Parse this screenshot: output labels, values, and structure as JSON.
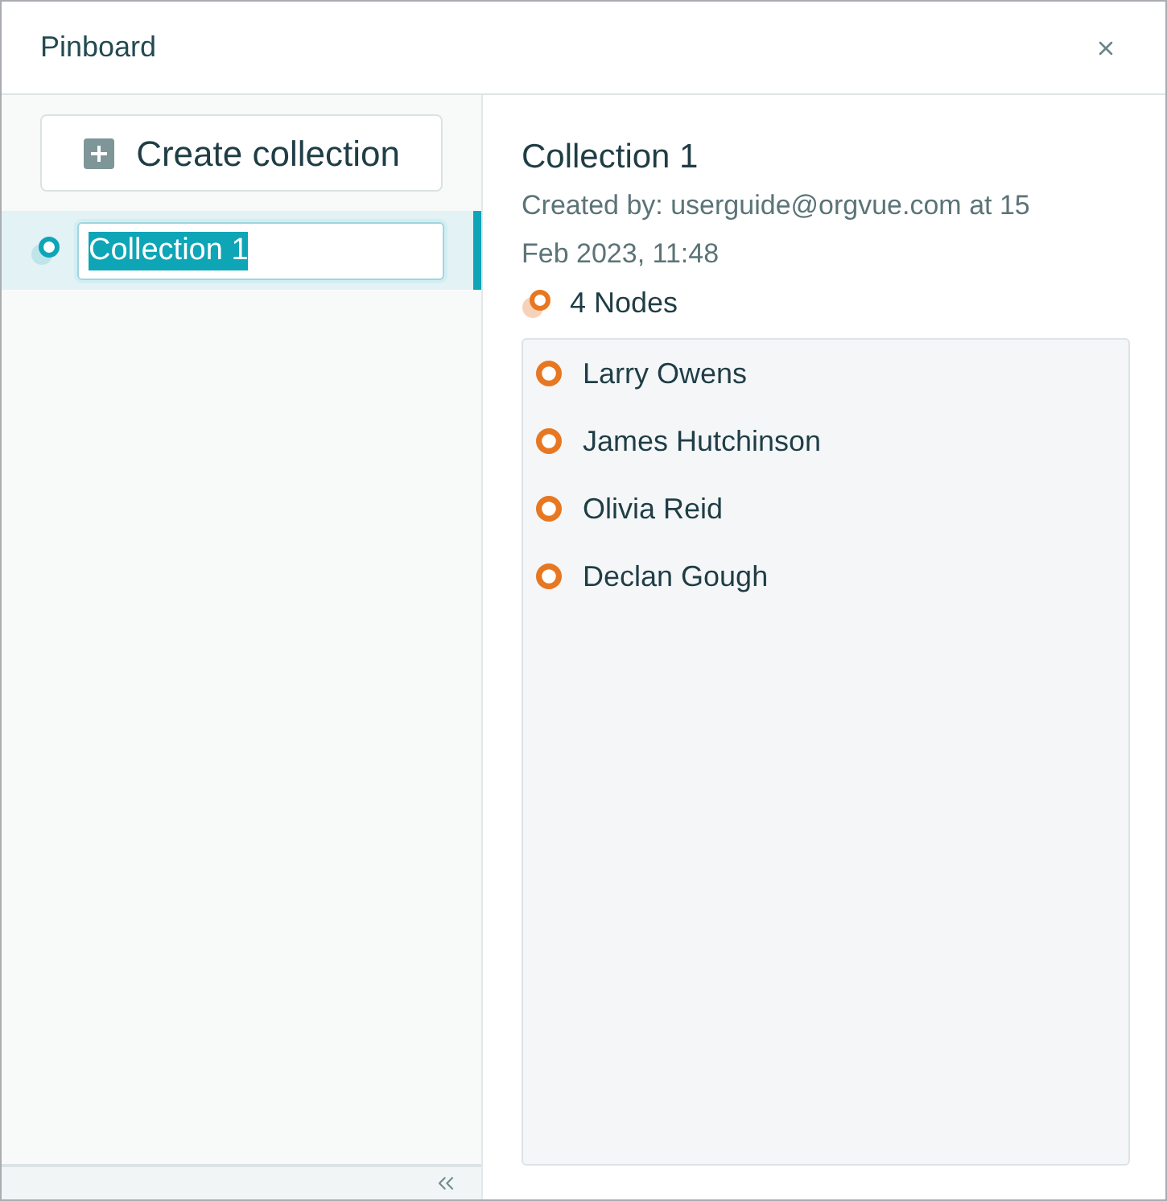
{
  "window": {
    "title": "Pinboard"
  },
  "sidebar": {
    "create_button": "Create collection",
    "collections": [
      {
        "name": "Collection 1",
        "selected": true,
        "editing": true
      }
    ]
  },
  "detail": {
    "title": "Collection 1",
    "created_by": "Created by: userguide@orgvue.com at 15 Feb 2023, 11:48",
    "node_count": "4 Nodes",
    "nodes": [
      {
        "name": "Larry Owens"
      },
      {
        "name": "James Hutchinson"
      },
      {
        "name": "Olivia Reid"
      },
      {
        "name": "Declan Gough"
      }
    ]
  }
}
